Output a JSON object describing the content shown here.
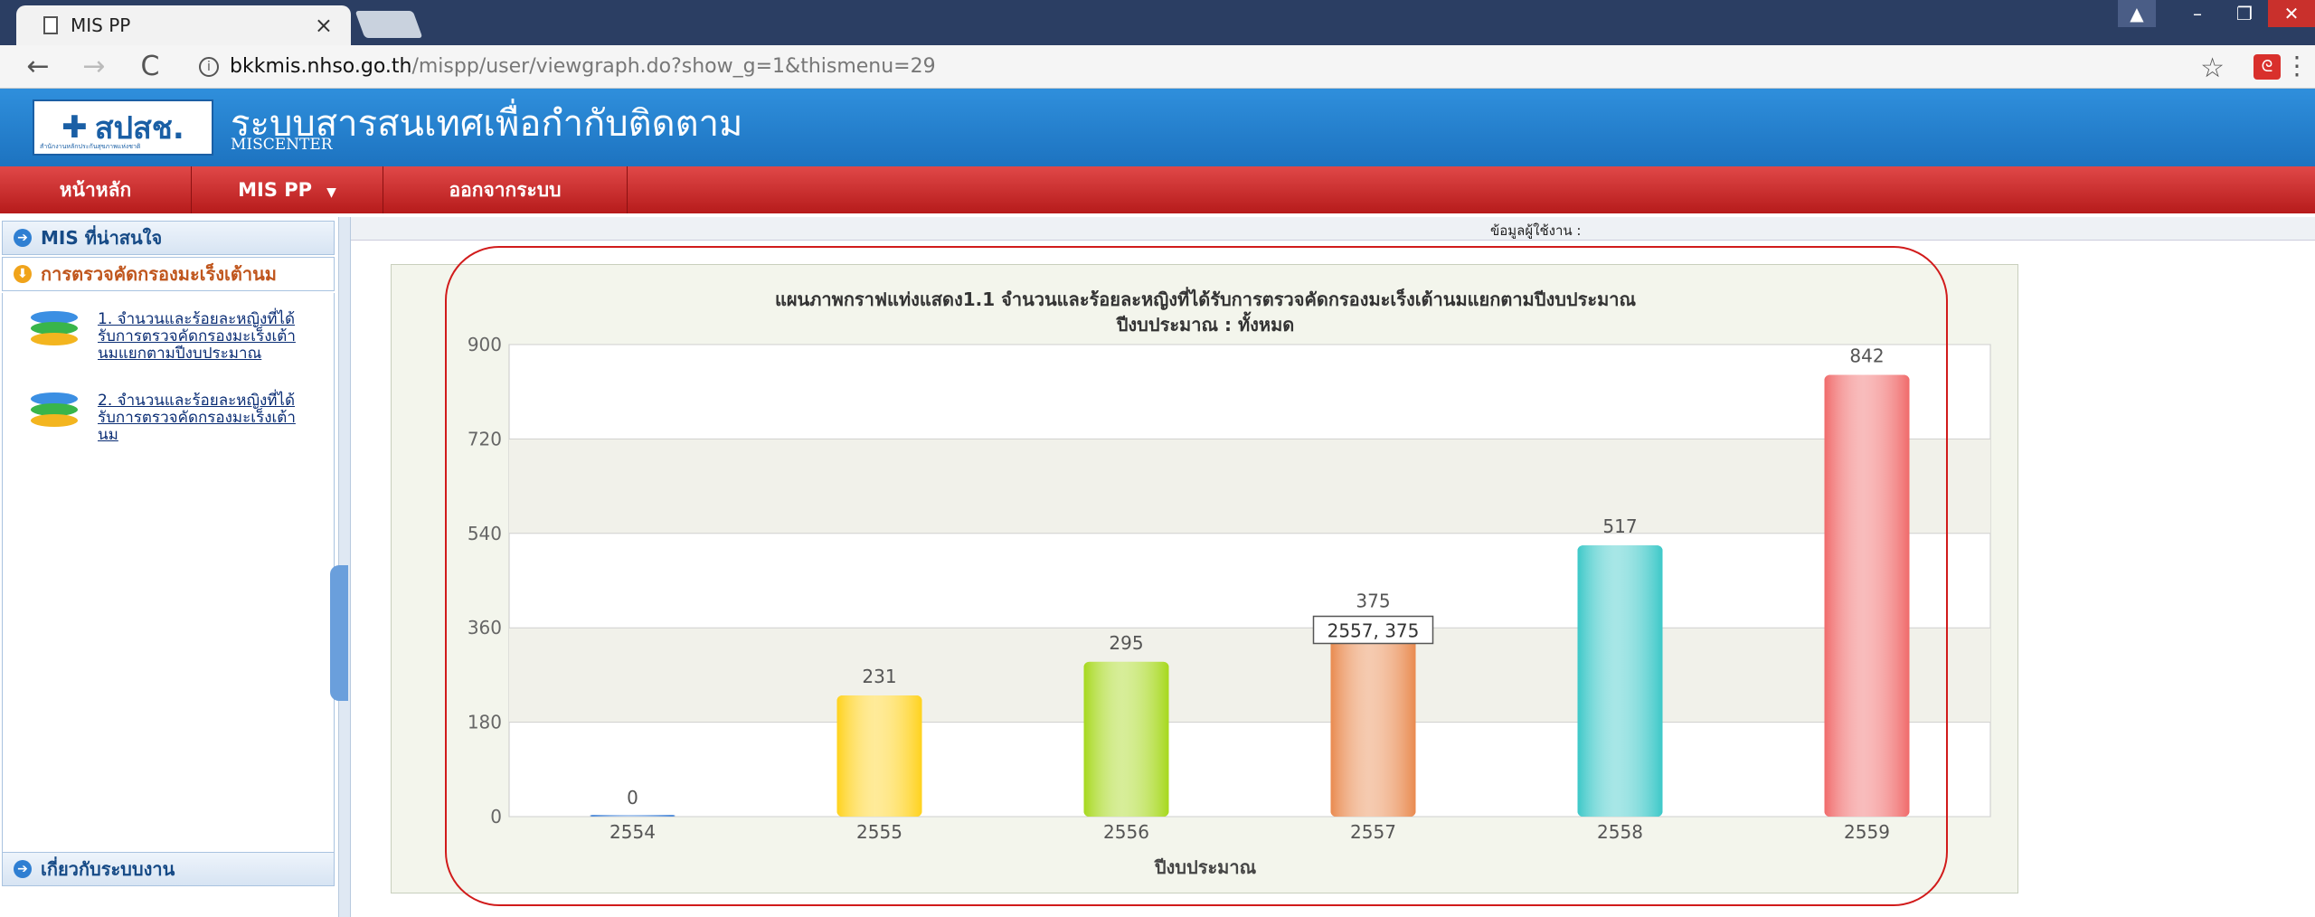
{
  "browser": {
    "tab_title": "MIS PP",
    "tab_close": "×",
    "url_host": "bkkmis.nhso.go.th",
    "url_path": "/mispp/user/viewgraph.do?show_g=1&thismenu=29",
    "back": "←",
    "forward": "→",
    "reload": "C",
    "info": "i",
    "star": "☆",
    "menu": "⋮",
    "ext_icon": "pdf-extension-icon"
  },
  "header": {
    "logo_text": "สปสช.",
    "logo_sub": "สำนักงานหลักประกันสุขภาพแห่งชาติ",
    "system_name": "ระบบสารสนเทศเพื่อกำกับติดตาม",
    "system_sub": "MISCENTER"
  },
  "nav": {
    "home": "หน้าหลัก",
    "mis_pp": "MIS PP",
    "logout": "ออกจากระบบ",
    "caret": "▼"
  },
  "sidebar": {
    "section1": "MIS ที่น่าสนใจ",
    "section2": "การตรวจคัดกรองมะเร็งเต้านม",
    "items": [
      {
        "label": "1. จำนวนและร้อยละหญิงที่ได้รับการตรวจคัดกรองมะเร็งเต้านมแยกตามปีงบประมาณ"
      },
      {
        "label": "2. จำนวนและร้อยละหญิงที่ได้รับการตรวจคัดกรองมะเร็งเต้านม"
      }
    ],
    "section3": "เกี่ยวกับระบบงาน"
  },
  "user_bar": {
    "label": "ข้อมูลผู้ใช้งาน :"
  },
  "chart_data": {
    "type": "bar",
    "title": "แผนภาพกราฟแท่งแสดง1.1 จำนวนและร้อยละหญิงที่ได้รับการตรวจคัดกรองมะเร็งเต้านมแยกตามปีงบประมาณ",
    "subtitle": "ปีงบประมาณ : ทั้งหมด",
    "xlabel": "ปีงบประมาณ",
    "ylabel": "",
    "categories": [
      "2554",
      "2555",
      "2556",
      "2557",
      "2558",
      "2559"
    ],
    "values": [
      0,
      231,
      295,
      375,
      517,
      842
    ],
    "ylim": [
      0,
      900
    ],
    "yticks": [
      0,
      180,
      360,
      540,
      720,
      900
    ],
    "colors": [
      "#4a88d8",
      "#ffd21c",
      "#a6d81c",
      "#e98a4f",
      "#3cc8c8",
      "#f06a6a"
    ],
    "tooltip": "2557, 375",
    "grid": true,
    "legend": "none"
  }
}
